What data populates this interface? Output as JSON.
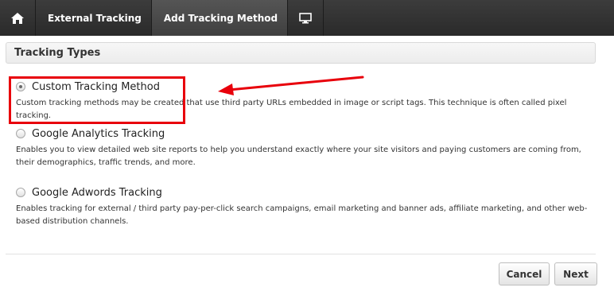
{
  "nav": {
    "home_icon": "home-icon",
    "tabs": [
      {
        "label": "External Tracking",
        "active": false
      },
      {
        "label": "Add Tracking Method",
        "active": true
      }
    ],
    "monitor_icon": "monitor-icon"
  },
  "section": {
    "title": "Tracking Types"
  },
  "options": [
    {
      "label": "Custom Tracking Method",
      "description": "Custom tracking methods may be created that use third party URLs embedded in image or script tags. This technique is often called pixel tracking.",
      "checked": true
    },
    {
      "label": "Google Analytics Tracking",
      "description": "Enables you to view detailed web site reports to help you understand exactly where your site visitors and paying customers are coming from, their demographics, traffic trends, and more.",
      "checked": false
    },
    {
      "label": "Google Adwords Tracking",
      "description": "Enables tracking for external / third party pay-per-click search campaigns, email marketing and banner ads, affiliate marketing, and other web-based distribution channels.",
      "checked": false
    }
  ],
  "buttons": {
    "cancel": "Cancel",
    "next": "Next"
  },
  "colors": {
    "annotation": "#e8000b",
    "topbar": "#333333"
  }
}
